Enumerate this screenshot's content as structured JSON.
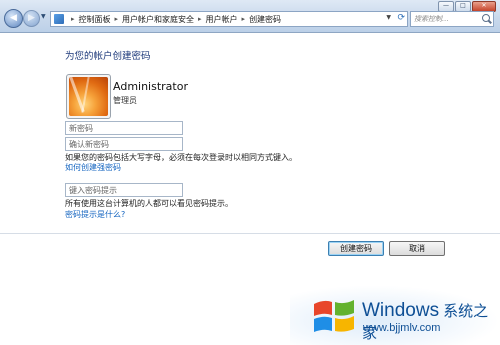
{
  "window": {
    "minimize": "—",
    "maximize": "□",
    "close": "✕"
  },
  "address_bar": {
    "breadcrumbs": [
      "控制面板",
      "用户帐户和家庭安全",
      "用户帐户",
      "创建密码"
    ],
    "search_placeholder": "搜索控制..."
  },
  "page": {
    "title": "为您的帐户创建密码",
    "user": {
      "name": "Administrator",
      "role": "管理员"
    },
    "fields": {
      "new_password": "新密码",
      "confirm_password": "确认新密码",
      "hint": "键入密码提示"
    },
    "caps_notice": "如果您的密码包括大写字母，必须在每次登录时以相同方式键入。",
    "strong_password_link": "如何创建强密码",
    "hint_notice": "所有使用这台计算机的人都可以看见密码提示。",
    "hint_link": "密码提示是什么?",
    "buttons": {
      "create": "创建密码",
      "cancel": "取消"
    }
  },
  "watermark": {
    "brand": "Windows",
    "brand_cn": "系统之家",
    "url": "www.bjjmlv.com"
  }
}
